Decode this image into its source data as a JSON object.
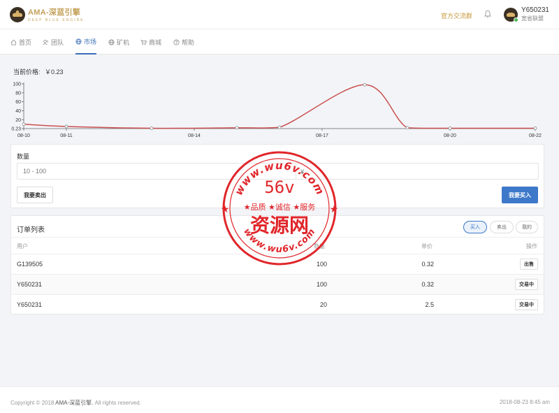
{
  "header": {
    "logo_title": "AMA-深蓝引擎",
    "logo_sub": "DEEP BLUE ENGINE",
    "group_link": "官方交流群",
    "user_name": "Y650231",
    "user_role": "宽省联盟"
  },
  "nav": {
    "items": [
      {
        "label": "首页",
        "icon": "home-icon"
      },
      {
        "label": "团队",
        "icon": "team-icon"
      },
      {
        "label": "市场",
        "icon": "globe-icon"
      },
      {
        "label": "矿机",
        "icon": "globe-icon"
      },
      {
        "label": "商城",
        "icon": "cart-icon"
      },
      {
        "label": "帮助",
        "icon": "help-icon"
      }
    ],
    "active": "市场"
  },
  "market": {
    "price_label": "当前价格:",
    "price_value": "￥0.23"
  },
  "chart_data": {
    "type": "line",
    "x_tick_labels": [
      "08-10",
      "08-11",
      "08-14",
      "08-17",
      "08-20",
      "08-22"
    ],
    "x": [
      "08-10",
      "08-11",
      "08-13",
      "08-15",
      "08-16",
      "08-18",
      "08-19",
      "08-20",
      "08-22"
    ],
    "y": [
      10,
      5,
      1,
      2,
      3,
      98,
      2,
      1,
      1
    ],
    "y_ticks": [
      0.23,
      20,
      40,
      60,
      80,
      100
    ],
    "y_tick_labels": [
      "0.23",
      "20",
      "40",
      "60",
      "80",
      "100"
    ],
    "ylim": [
      0.23,
      100
    ],
    "color": "#c9504f",
    "grid": false
  },
  "trade": {
    "qty_label": "数量",
    "qty_placeholder": "10 - 100",
    "price_label": "单价",
    "currency": "¥",
    "sell_label": "我要卖出",
    "buy_label": "我要买入"
  },
  "orders": {
    "title": "订单列表",
    "tabs": [
      "买入",
      "卖出",
      "我的"
    ],
    "headers": {
      "user": "用户",
      "qty": "数量",
      "price": "单价",
      "action": "操作"
    },
    "rows": [
      {
        "user": "G139505",
        "qty": "100",
        "price": "0.32",
        "action": "出售"
      },
      {
        "user": "Y650231",
        "qty": "100",
        "price": "0.32",
        "action": "交易中"
      },
      {
        "user": "Y650231",
        "qty": "20",
        "price": "2.5",
        "action": "交易中"
      }
    ]
  },
  "footer": {
    "copyright_prefix": "Copyright © 2018",
    "brand": "AMA-深蓝引擎.",
    "copyright_suffix": "All rights reserved.",
    "datetime": "2018-08-23 8:45 am"
  },
  "watermark": {
    "url": "www.wu6v.com",
    "big": "56v",
    "slogan": "★品质 ★诚信 ★服务",
    "name": "资源网"
  },
  "colors": {
    "accent": "#3d78c9",
    "gold": "#c79a3f",
    "line": "#c9504f",
    "stamp": "#e0262b"
  }
}
